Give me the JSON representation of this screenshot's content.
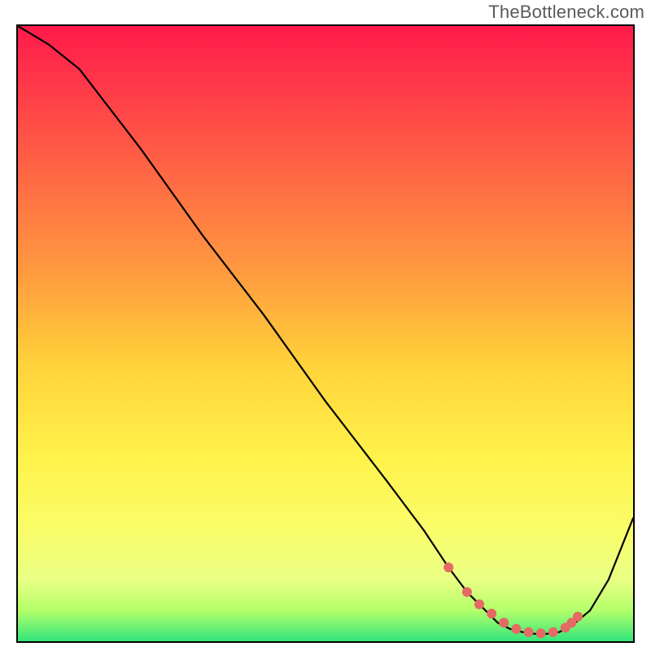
{
  "watermark": "TheBottleneck.com",
  "chart_data": {
    "type": "line",
    "title": "",
    "xlabel": "",
    "ylabel": "",
    "xlim": [
      0,
      100
    ],
    "ylim": [
      0,
      100
    ],
    "series": [
      {
        "name": "bottleneck-curve",
        "x": [
          0,
          5,
          10,
          20,
          30,
          40,
          50,
          60,
          66,
          70,
          73,
          76,
          78,
          80,
          82,
          84,
          86,
          88,
          90,
          93,
          96,
          100
        ],
        "y": [
          100,
          97,
          93,
          80,
          66,
          53,
          39,
          26,
          18,
          12,
          8,
          5,
          3,
          2,
          1.5,
          1.2,
          1.2,
          1.5,
          2.5,
          5,
          10,
          20
        ]
      }
    ],
    "markers": {
      "name": "optimal-range-dots",
      "color": "#e46a63",
      "x": [
        70,
        73,
        75,
        77,
        79,
        81,
        83,
        85,
        87,
        89,
        90,
        91
      ],
      "y": [
        12,
        8,
        6,
        4.5,
        3,
        2,
        1.5,
        1.3,
        1.5,
        2.2,
        3,
        4
      ]
    },
    "gradient": {
      "stops": [
        {
          "pos": 0,
          "color": "#ff1a4b"
        },
        {
          "pos": 10,
          "color": "#ff3a49"
        },
        {
          "pos": 25,
          "color": "#ff6a44"
        },
        {
          "pos": 40,
          "color": "#ff9a3f"
        },
        {
          "pos": 55,
          "color": "#ffd23a"
        },
        {
          "pos": 70,
          "color": "#fff24a"
        },
        {
          "pos": 82,
          "color": "#fafd6a"
        },
        {
          "pos": 90,
          "color": "#e9ff84"
        },
        {
          "pos": 95,
          "color": "#b4ff6a"
        },
        {
          "pos": 100,
          "color": "#32e57c"
        }
      ]
    }
  }
}
